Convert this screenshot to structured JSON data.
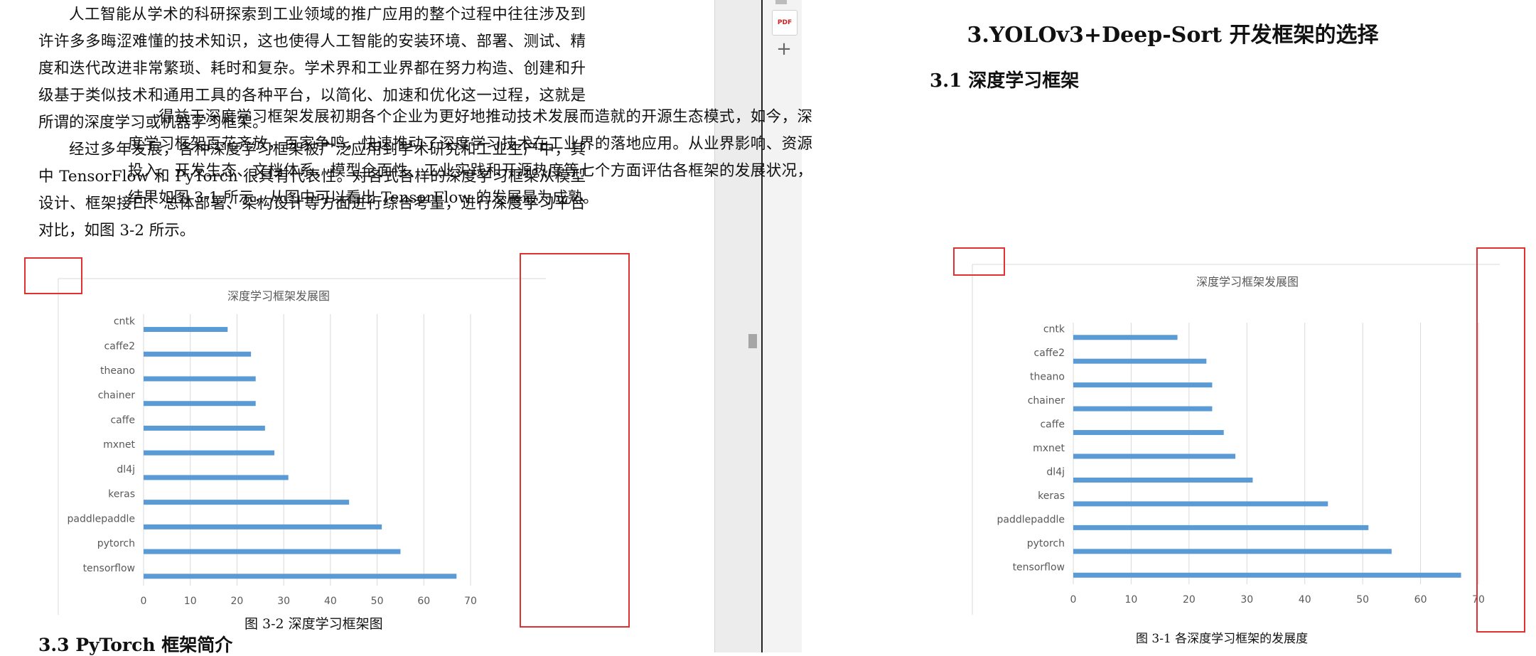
{
  "left": {
    "para1": "人工智能从学术的科研探索到工业领域的推广应用的整个过程中往往涉及到许许多多晦涩难懂的技术知识，这也使得人工智能的安装环境、部署、测试、精度和迭代改进非常繁琐、耗时和复杂。学术界和工业界都在努力构造、创建和升级基于类似技术和通用工具的各种平台，以简化、加速和优化这一过程，这就是所谓的深度学习或机器学习框架。",
    "para2": "经过多年发展，各种深度学习框架被广泛应用到学术研究和工业生产中，其中 TensorFlow 和 PyTorch 很具有代表性。对各式各样的深度学习框架从模型设计、框架接口、总体部署、架构设计等方面进行综合考量，进行深度学习平台对比，如图 3-2 所示。",
    "caption": "图 3-2  深度学习框架图",
    "section_heading": "3.3  PyTorch 框架简介"
  },
  "right": {
    "heading": "3.YOLOv3+Deep-Sort 开发框架的选择",
    "subheading": "3.1 深度学习框架",
    "para1": "得益于深度学习框架发展初期各个企业为更好地推动技术发展而造就的开源生态模式，如今，深度学习框架百花齐放，百家争鸣，快速推动了深度学习技术在工业界的落地应用。从业界影响、资源投入、开发生态、文档体系、模型全面性、工业实践和开源热度等七个方面评估各框架的发展状况，结果如图 3-1 所示，从图中可以看出 TensorFlow 的发展最为成熟。",
    "caption": "图 3-1  各深度学习框架的发展度"
  },
  "toolbar": {
    "pdf_icon": "pdf-icon",
    "pdf_label": "PDF",
    "add_icon": "plus-icon",
    "add_label": "+"
  },
  "colors": {
    "bar": "#5b9bd5",
    "annotation_box": "#e03131",
    "gridline": "#d9d9d9"
  },
  "chart_data": [
    {
      "type": "bar",
      "orientation": "horizontal",
      "title": "深度学习框架发展图",
      "categories": [
        "cntk",
        "caffe2",
        "theano",
        "chainer",
        "caffe",
        "mxnet",
        "dl4j",
        "keras",
        "paddlepaddle",
        "pytorch",
        "tensorflow"
      ],
      "values": [
        18,
        23,
        24,
        24,
        26,
        28,
        31,
        44,
        51,
        55,
        67
      ],
      "xlim": [
        0,
        70
      ],
      "xticks": [
        0,
        10,
        20,
        30,
        40,
        50,
        60,
        70
      ],
      "grid": true,
      "legend": "none"
    },
    {
      "type": "bar",
      "orientation": "horizontal",
      "title": "深度学习框架发展图",
      "categories": [
        "cntk",
        "caffe2",
        "theano",
        "chainer",
        "caffe",
        "mxnet",
        "dl4j",
        "keras",
        "paddlepaddle",
        "pytorch",
        "tensorflow"
      ],
      "values": [
        18,
        23,
        24,
        24,
        26,
        28,
        31,
        44,
        51,
        55,
        67
      ],
      "xlim": [
        0,
        70
      ],
      "xticks": [
        0,
        10,
        20,
        30,
        40,
        50,
        60,
        70
      ],
      "grid": true,
      "legend": "none"
    }
  ]
}
